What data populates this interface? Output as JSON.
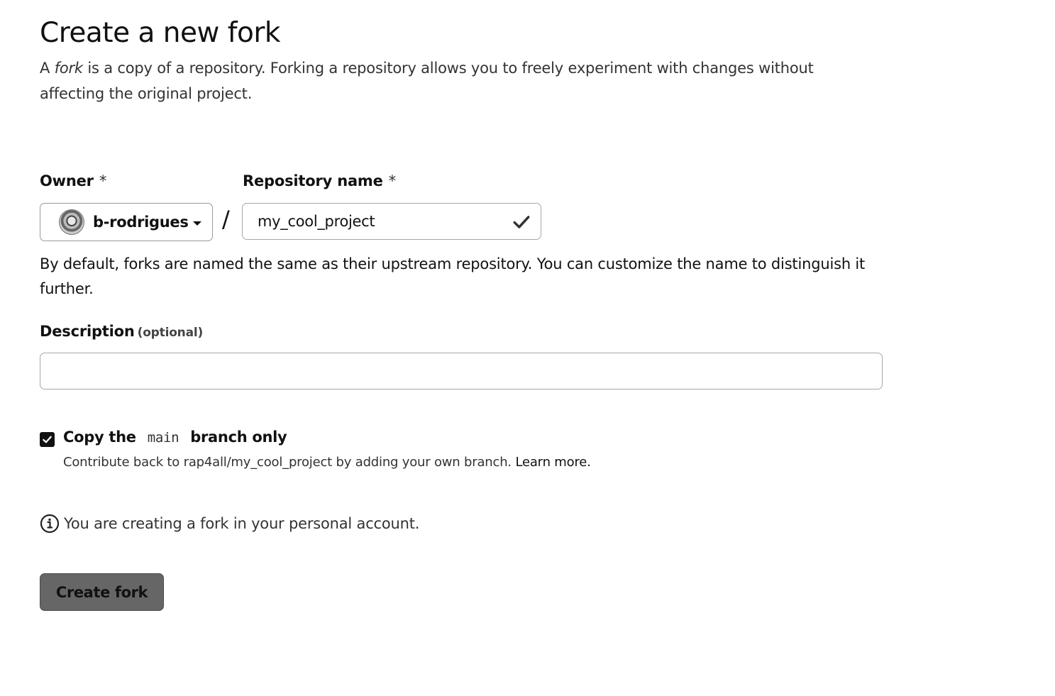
{
  "header": {
    "title": "Create a new fork",
    "intro_prefix": "A ",
    "intro_emphasis": "fork",
    "intro_rest": " is a copy of a repository. Forking a repository allows you to freely experiment with changes without affecting the original project."
  },
  "form": {
    "owner_label": "Owner",
    "required_mark": "*",
    "owner_value": "b-rodrigues",
    "slash": "/",
    "repo_label": "Repository name",
    "repo_value": "my_cool_project",
    "name_help": "By default, forks are named the same as their upstream repository. You can customize the name to distinguish it further.",
    "description_label": "Description",
    "description_optional": "(optional)",
    "description_value": "",
    "copy_branch_prefix": "Copy the",
    "copy_branch_code": "main",
    "copy_branch_suffix": "branch only",
    "copy_branch_checked": true,
    "copy_branch_sub": "Contribute back to rap4all/my_cool_project by adding your own branch.",
    "learn_more": "Learn more.",
    "info_text": "You are creating a fork in your personal account.",
    "submit_label": "Create fork"
  },
  "icons": {
    "owner_avatar": "avatar",
    "owner_caret": "caret-down-icon",
    "repo_valid": "check-icon",
    "checkbox": "checkbox-checked-icon",
    "info": "info-icon"
  }
}
